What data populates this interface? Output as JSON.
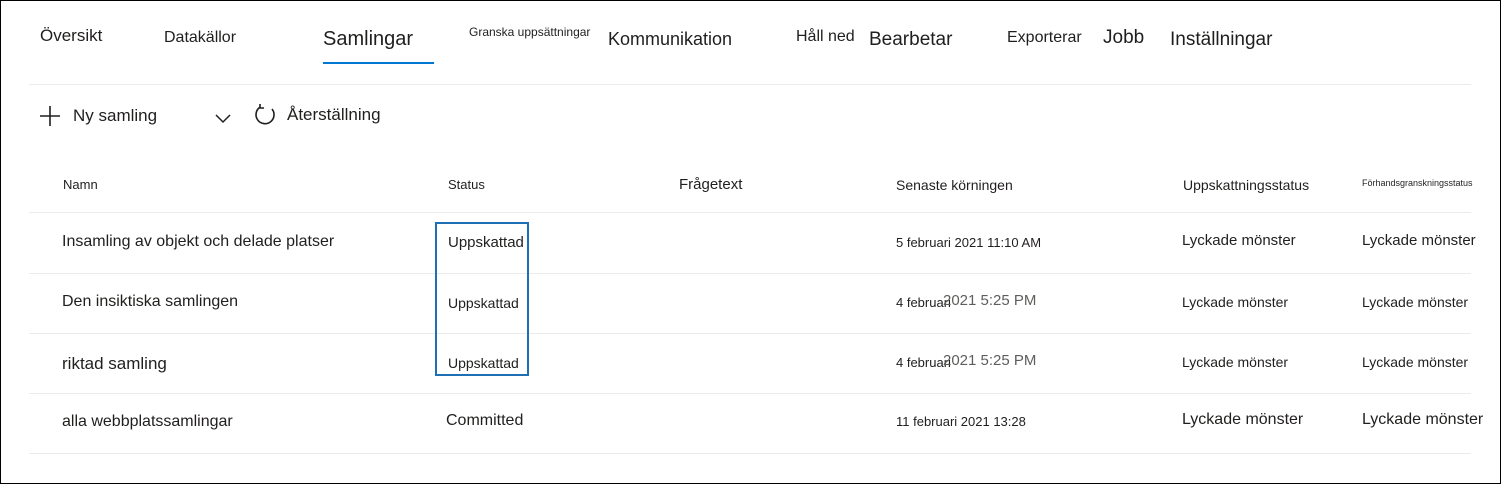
{
  "nav": {
    "tabs": [
      {
        "label": "Översikt"
      },
      {
        "label": "Datakällor"
      },
      {
        "label": "Samlingar",
        "selected": true
      },
      {
        "label": "Granska uppsättningar"
      },
      {
        "label": "Kommunikation"
      },
      {
        "label": "Håll ned"
      },
      {
        "label": "Bearbetar"
      },
      {
        "label": "Exporterar"
      },
      {
        "label": "Jobb"
      },
      {
        "label": "Inställningar"
      }
    ]
  },
  "toolbar": {
    "new_collection_label": "Ny samling",
    "refresh_label": "Återställning",
    "icons": {
      "new": "plus-icon",
      "dropdown": "chevron-down-icon",
      "refresh": "refresh-icon"
    }
  },
  "table": {
    "columns": [
      "Namn",
      "Status",
      "Frågetext",
      "Senaste körningen",
      "Uppskattningsstatus",
      "Förhandsgranskningsstatus"
    ],
    "rows": [
      {
        "name": "Insamling av objekt och delade platser",
        "status": "Uppskattad",
        "query": "",
        "last_run": "5 februari 2021 11:10 AM",
        "estimate_status": "Lyckade mönster",
        "preview_status": "Lyckade mönster"
      },
      {
        "name": "Den insiktiska samlingen",
        "status": "Uppskattad",
        "query": "",
        "last_run_date": "4 februari",
        "last_run_time": "2021 5:25 PM",
        "estimate_status": "Lyckade mönster",
        "preview_status": "Lyckade mönster"
      },
      {
        "name": "riktad samling",
        "status": "Uppskattad",
        "query": "",
        "last_run_date": "4 februari",
        "last_run_time": "2021 5:25 PM",
        "estimate_status": "Lyckade mönster",
        "preview_status": "Lyckade mönster"
      },
      {
        "name": "alla webbplatssamlingar",
        "status": "Committed",
        "query": "",
        "last_run": "11 februari 2021 13:28",
        "estimate_status": "Lyckade mönster",
        "preview_status": "Lyckade mönster"
      }
    ]
  },
  "colors": {
    "accent": "#0078d4",
    "highlight_border": "#1f6fb5",
    "divider": "#edebe9",
    "text": "#201f1e"
  }
}
